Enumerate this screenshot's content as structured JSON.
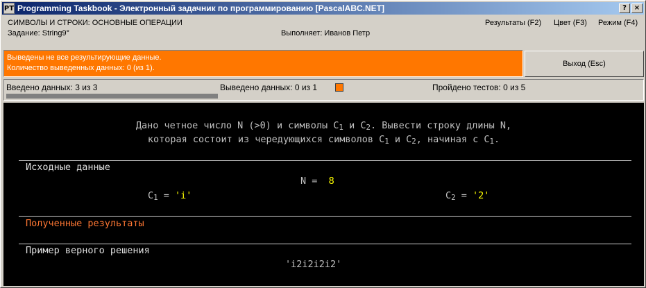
{
  "window": {
    "icon_label": "PT",
    "title": "Programming Taskbook - Электронный задачник по программированию [PascalABC.NET]",
    "help_button": "?",
    "close_button": "×"
  },
  "header": {
    "task_group": "СИМВОЛЫ И СТРОКИ: ОСНОВНЫЕ ОПЕРАЦИИ",
    "task_name": "Задание: String9°",
    "executor": "Выполняет: Иванов Петр",
    "menu": {
      "results": "Результаты (F2)",
      "color": "Цвет (F3)",
      "mode": "Режим (F4)"
    }
  },
  "status": {
    "message_line1": "Выведены не все результирующие данные.",
    "message_line2": "Количество выведенных данных: 0 (из 1).",
    "exit_button": "Выход (Esc)",
    "status_color": "#ff7700"
  },
  "info": {
    "input_label": "Введено данных:",
    "input_value": "3 из 3",
    "output_label": "Выведено данных:",
    "output_value": "0 из 1",
    "tests_label": "Пройдено тестов:",
    "tests_value": "0 из 5",
    "progress_fraction": 1.0
  },
  "console": {
    "task_line1_a": "Дано четное число N (>0) и символы C",
    "task_line1_sub1": "1",
    "task_line1_b": " и C",
    "task_line1_sub2": "2",
    "task_line1_c": ". Вывести строку длины N,",
    "task_line2_a": "которая состоит из чередующихся символов C",
    "task_line2_sub1": "1",
    "task_line2_b": " и C",
    "task_line2_sub2": "2",
    "task_line2_c": ", начиная с C",
    "task_line2_sub3": "1",
    "task_line2_d": ".",
    "input_header": "Исходные данные",
    "n_label": "N = ",
    "n_value": "8",
    "c1_label": "C",
    "c1_sub": "1",
    "c1_eq": " = ",
    "c1_value": "'i'",
    "c2_label": "C",
    "c2_sub": "2",
    "c2_eq": " = ",
    "c2_value": "'2'",
    "results_header": "Полученные результаты",
    "example_header": "Пример верного решения",
    "example_value": "'i2i2i2i2'"
  }
}
